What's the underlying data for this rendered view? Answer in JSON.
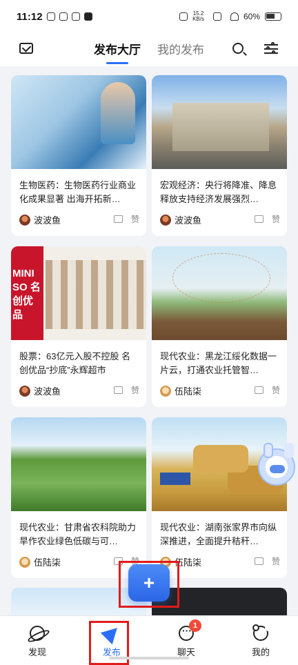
{
  "status_bar": {
    "time": "11:12",
    "net_speed_value": "15.2",
    "net_speed_unit": "KB/s",
    "battery": "60%"
  },
  "header": {
    "tab_active": "发布大厅",
    "tab_inactive": "我的发布"
  },
  "cards": [
    {
      "title": "生物医药：生物医药行业商业化成果显著 出海开拓新…",
      "author": "波波鱼",
      "like": "赞"
    },
    {
      "title": "宏观经济：央行将降准、降息 释放支持经济发展强烈…",
      "author": "波波鱼",
      "like": "赞"
    },
    {
      "title": "股票：63亿元入股不控股 名创优品“抄底”永辉超市",
      "author": "波波鱼",
      "like": "赞",
      "logo_text": "MINI SO 名创优品"
    },
    {
      "title": "现代农业：黑龙江绥化数据一片云，打通农业托管智…",
      "author": "伍陆柒",
      "like": "赞"
    },
    {
      "title": "现代农业：甘肃省农科院助力旱作农业绿色低碳与可…",
      "author": "伍陆柒",
      "like": "赞"
    },
    {
      "title": "现代农业：湖南张家界市向纵深推进，全面提升秸秆…",
      "author": "伍陆柒",
      "like": "赞"
    }
  ],
  "fab": {
    "label": "+"
  },
  "bottom_nav": {
    "items": [
      {
        "label": "发现",
        "icon": "planet-icon"
      },
      {
        "label": "发布",
        "icon": "send-icon"
      },
      {
        "label": "聊天",
        "icon": "chat-icon"
      },
      {
        "label": "我的",
        "icon": "bear-icon"
      }
    ],
    "chat_badge": "1"
  },
  "colors": {
    "accent": "#2b6ef6",
    "highlight": "#e21b1b",
    "badge": "#f04a3a"
  }
}
